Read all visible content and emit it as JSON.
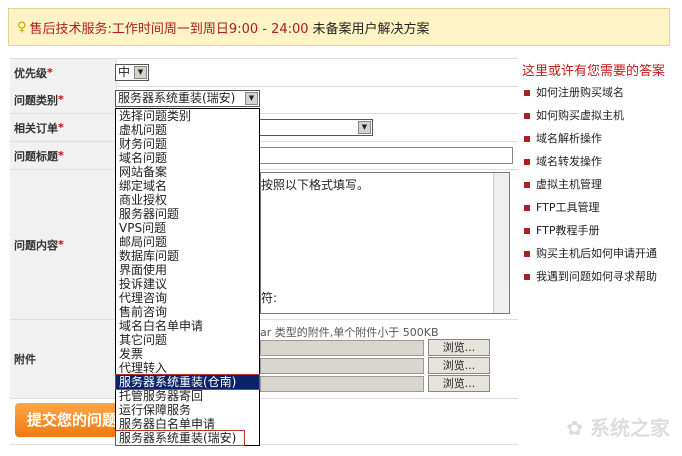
{
  "banner": {
    "title": "售后技术服务",
    "hours": ":工作时间周一到周日9:00 - 24:00",
    "link": "未备案用户解决方案"
  },
  "form": {
    "priority": {
      "label": "优先级",
      "value": "中"
    },
    "category": {
      "label": "问题类别",
      "value": "服务器系统重装(瑞安)"
    },
    "order": {
      "label": "相关订单"
    },
    "title": {
      "label": "问题标题"
    },
    "content": {
      "label": "问题内容",
      "line1": "按照以下格式填写。",
      "line2": "符:"
    },
    "attachment": {
      "label": "附件",
      "hint": "ar 类型的附件,单个附件小于 500KB",
      "browse": "浏览..."
    },
    "submit": "提交您的问题",
    "required": "*"
  },
  "dropdown": {
    "options": [
      "选择问题类别",
      "虚机问题",
      "财务问题",
      "域名问题",
      "网站备案",
      "绑定域名",
      "商业授权",
      "服务器问题",
      "VPS问题",
      "邮局问题",
      "数据库问题",
      "界面使用",
      "投诉建议",
      "代理咨询",
      "售前咨询",
      "域名白名单申请",
      "其它问题",
      "发票",
      "代理转入",
      "服务器系统重装(仓南)",
      "托管服务器寄回",
      "运行保障服务",
      "服务器白名单申请",
      "服务器系统重装(瑞安)"
    ],
    "highlighted": "服务器系统重装(仓南)"
  },
  "help": {
    "title": "这里或许有您需要的答案",
    "items": [
      "如何注册购买域名",
      "如何购买虚拟主机",
      "域名解析操作",
      "域名转发操作",
      "虚拟主机管理",
      "FTP工具管理",
      "FTP教程手册",
      "购买主机后如何申请开通",
      "我遇到问题如何寻求帮助"
    ]
  },
  "watermark": "系统之家"
}
